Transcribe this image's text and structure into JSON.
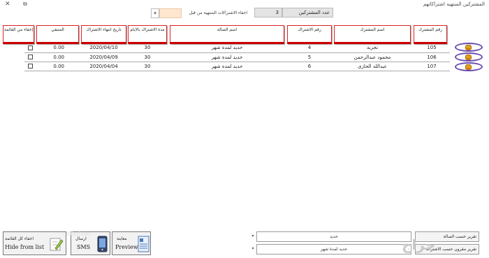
{
  "window": {
    "title": "المشتركين المنتهية اشتراكاتهم",
    "close_glyph": "✕",
    "restore_glyph": "⧉"
  },
  "filter": {
    "subscribers_count_label": "عدد المشتركين",
    "subscribers_count_value": "3",
    "hide_label": "اخفاء الاشتراكات المنتهية من قبل",
    "hide_value": ""
  },
  "table": {
    "headers": [
      "رقم المشترك",
      "اسم المشترك",
      "رقم الاشتراك",
      "اسم الصالة",
      "مدة الاشتراك بالايام",
      "تاريخ انتهاء الاشتراك",
      "المتبقي",
      "إخفاء من القائمة"
    ],
    "rows": [
      {
        "id": "105",
        "name": "تجربة",
        "subscription_no": "4",
        "hall": "حديد لمدة شهر",
        "days": "30",
        "end_date": "2020/04/10",
        "remaining": "0.00",
        "hidden": false
      },
      {
        "id": "106",
        "name": "محمود عبدالرحمن",
        "subscription_no": "5",
        "hall": "حديد لمدة شهر",
        "days": "30",
        "end_date": "2020/04/09",
        "remaining": "0.00",
        "hidden": false
      },
      {
        "id": "107",
        "name": "عبدالله الحازى",
        "subscription_no": "6",
        "hall": "حديد لمدة شهر",
        "days": "30",
        "end_date": "2020/04/04",
        "remaining": "0.00",
        "hidden": false
      }
    ]
  },
  "buttons": {
    "hide_all_ar": "اخفاء كل القائمة",
    "hide_all_en": "Hide from list",
    "sms_ar": "ارسال",
    "sms_en": "SMS",
    "preview_ar": "معاينة",
    "preview_en": "Preview"
  },
  "reports": {
    "by_hall_label": "تقرير حسب الصالة",
    "by_hall_value": "حديد",
    "by_type_label": "تقرير مقرون حسب الاشتراك",
    "by_type_value": "حديد لمدة شهر"
  },
  "watermark": {
    "text": "حراج",
    "small": "Windows"
  },
  "colors": {
    "header_border": "#cc0000",
    "oval": "#6a4bb0",
    "peach": "#ffe7cf"
  },
  "icons": [
    "close-icon",
    "restore-icon",
    "smiley-icon",
    "pencil-icon",
    "phone-icon",
    "document-icon"
  ]
}
